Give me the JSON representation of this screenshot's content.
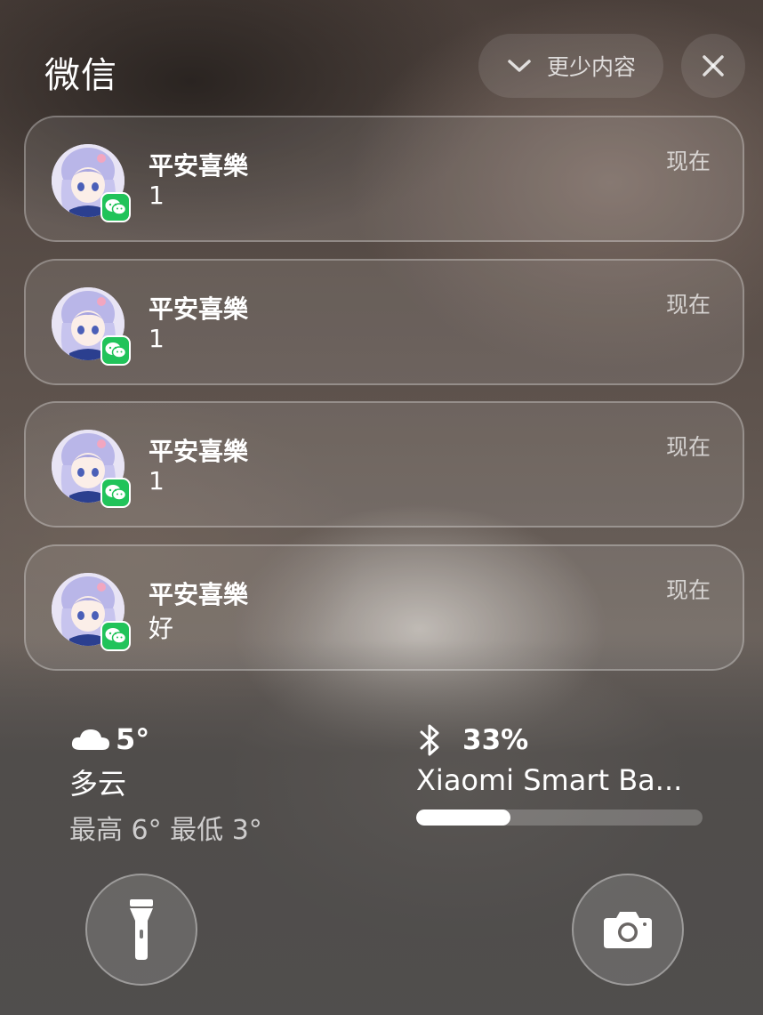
{
  "header": {
    "app_title": "微信",
    "show_less_label": "更少内容",
    "chevron_icon": "chevron-down-icon",
    "close_icon": "close-icon"
  },
  "notifications": [
    {
      "sender": "平安喜樂",
      "message": "1",
      "time": "现在",
      "app_icon": "wechat-icon"
    },
    {
      "sender": "平安喜樂",
      "message": "1",
      "time": "现在",
      "app_icon": "wechat-icon"
    },
    {
      "sender": "平安喜樂",
      "message": "1",
      "time": "现在",
      "app_icon": "wechat-icon"
    },
    {
      "sender": "平安喜樂",
      "message": "好",
      "time": "现在",
      "app_icon": "wechat-icon"
    }
  ],
  "weather": {
    "icon": "cloud-icon",
    "temperature": "5°",
    "condition": "多云",
    "range": "最高 6° 最低 3°"
  },
  "battery_widget": {
    "icon": "bluetooth-icon",
    "percent_label": "33%",
    "level": 0.33,
    "device_name": "Xiaomi Smart Ba..."
  },
  "quick_actions": {
    "left_icon": "flashlight-icon",
    "right_icon": "camera-icon"
  },
  "colors": {
    "wechat_green": "#21c35a",
    "accent_white": "#ffffff"
  }
}
